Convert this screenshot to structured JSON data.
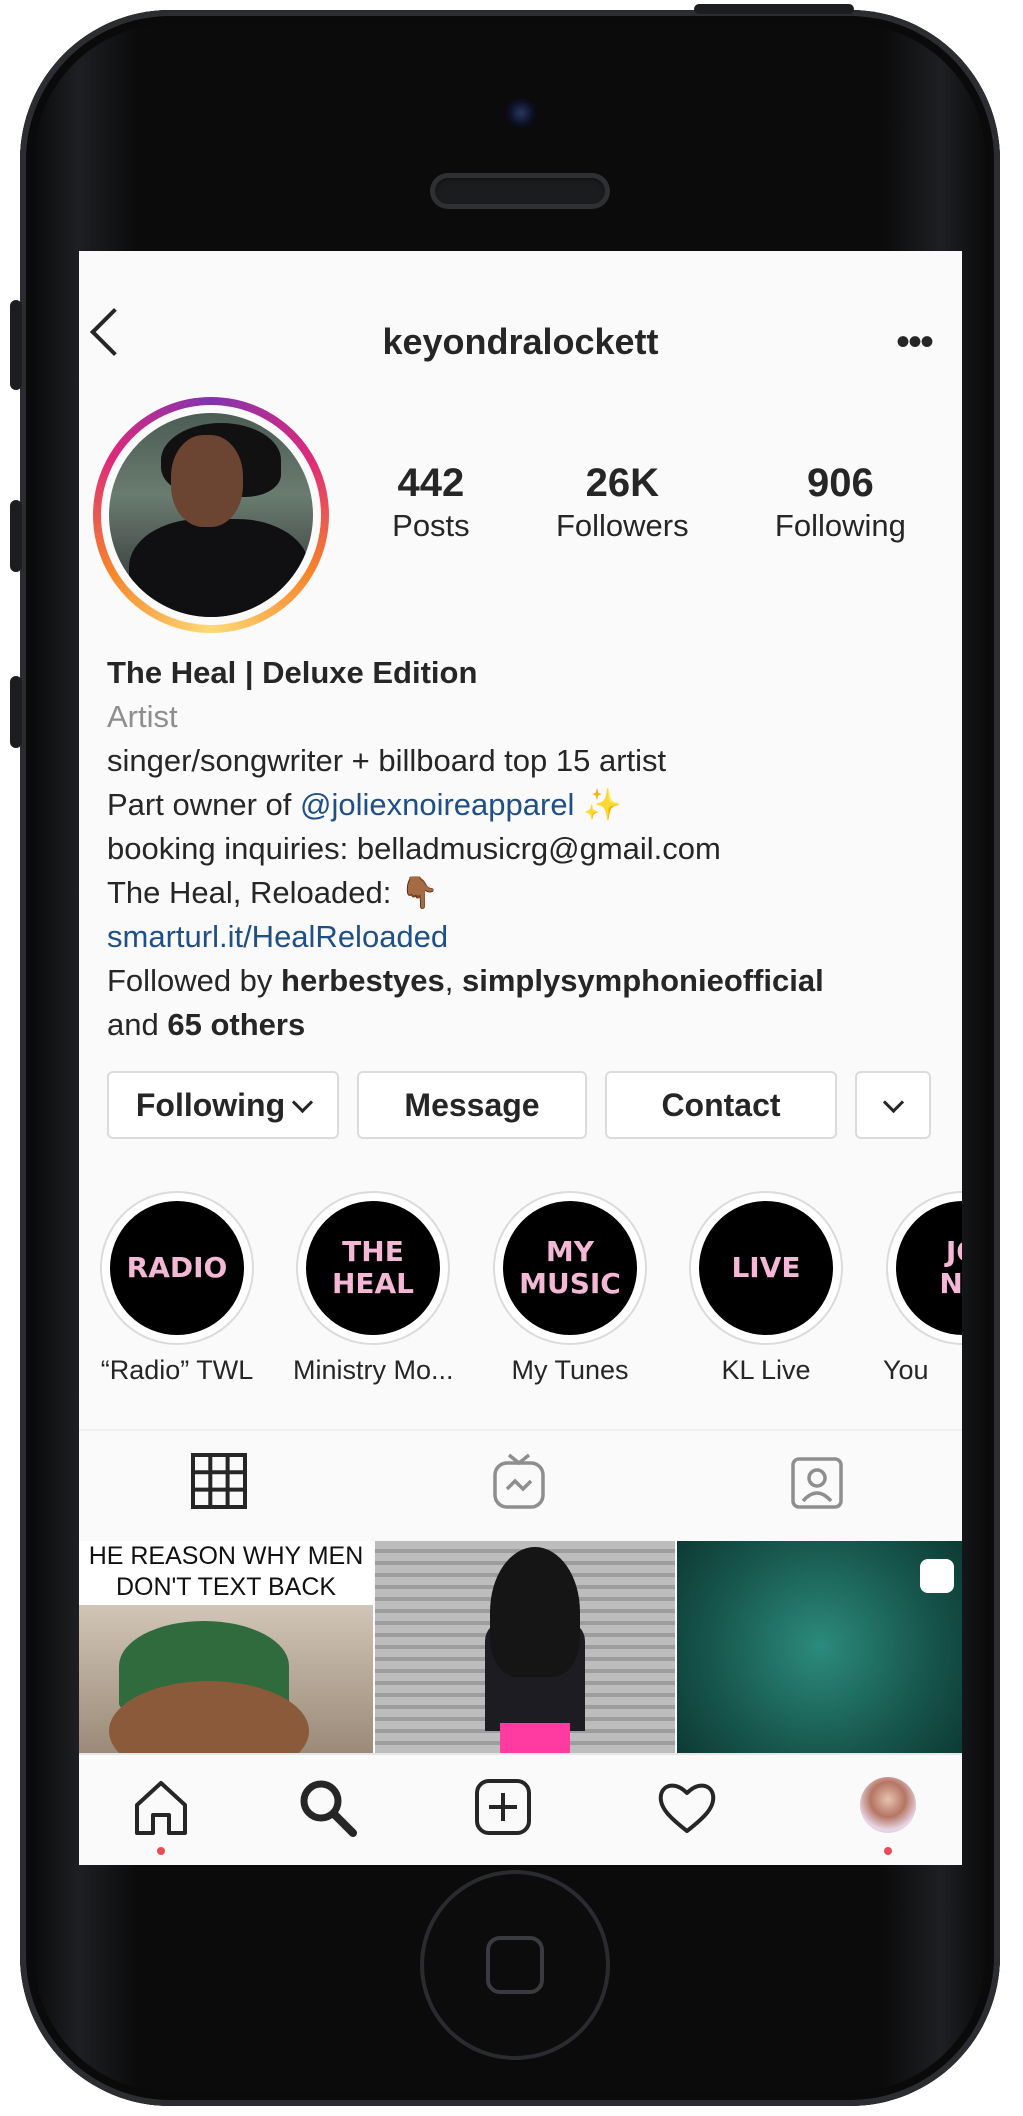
{
  "profile": {
    "username": "keyondralockett",
    "stats": [
      {
        "value": "442",
        "label": "Posts"
      },
      {
        "value": "26K",
        "label": "Followers"
      },
      {
        "value": "906",
        "label": "Following"
      }
    ],
    "bio": {
      "name": "The Heal | Deluxe Edition",
      "category": "Artist",
      "line1": "singer/songwriter + billboard top 15 artist",
      "line2_prefix": "Part owner of ",
      "line2_mention": "@joliexnoireapparel",
      "line2_emoji": "✨",
      "line3": "booking inquiries: belladmusicrg@gmail.com",
      "line4_prefix": "The Heal, Reloaded: ",
      "line4_emoji": "👇🏾",
      "website": "smarturl.it/HealReloaded",
      "followed_prefix": "Followed by ",
      "followed_user1": "herbestyes",
      "followed_sep": ", ",
      "followed_user2": "simplysymphonieofficial",
      "followed_and": "and ",
      "followed_others": "65 others"
    }
  },
  "actions": {
    "following": "Following",
    "message": "Message",
    "contact": "Contact"
  },
  "highlights": [
    {
      "cover": "RADIO",
      "caption": "“Radio” TWL"
    },
    {
      "cover": "THE\nHEAL",
      "caption": "Ministry Mo..."
    },
    {
      "cover": "MY\nMUSIC",
      "caption": "My Tunes"
    },
    {
      "cover": "LIVE",
      "caption": "KL Live"
    },
    {
      "cover": "JO\nNO",
      "caption": "You"
    }
  ],
  "posts": [
    {
      "caption": "HE REASON WHY MEN DON'T TEXT BACK"
    }
  ],
  "colors": {
    "link": "#1e4f86",
    "notification_dot": "#ed4956",
    "highlight_text": "#f4b7d6"
  },
  "icons": {
    "back": "chevron-left-icon",
    "more": "more-horizontal-icon",
    "grid": "grid-icon",
    "igtv": "igtv-icon",
    "tagged": "tagged-icon",
    "home": "home-icon",
    "search": "search-icon",
    "new_post": "plus-square-icon",
    "activity": "heart-icon",
    "profile": "avatar"
  }
}
